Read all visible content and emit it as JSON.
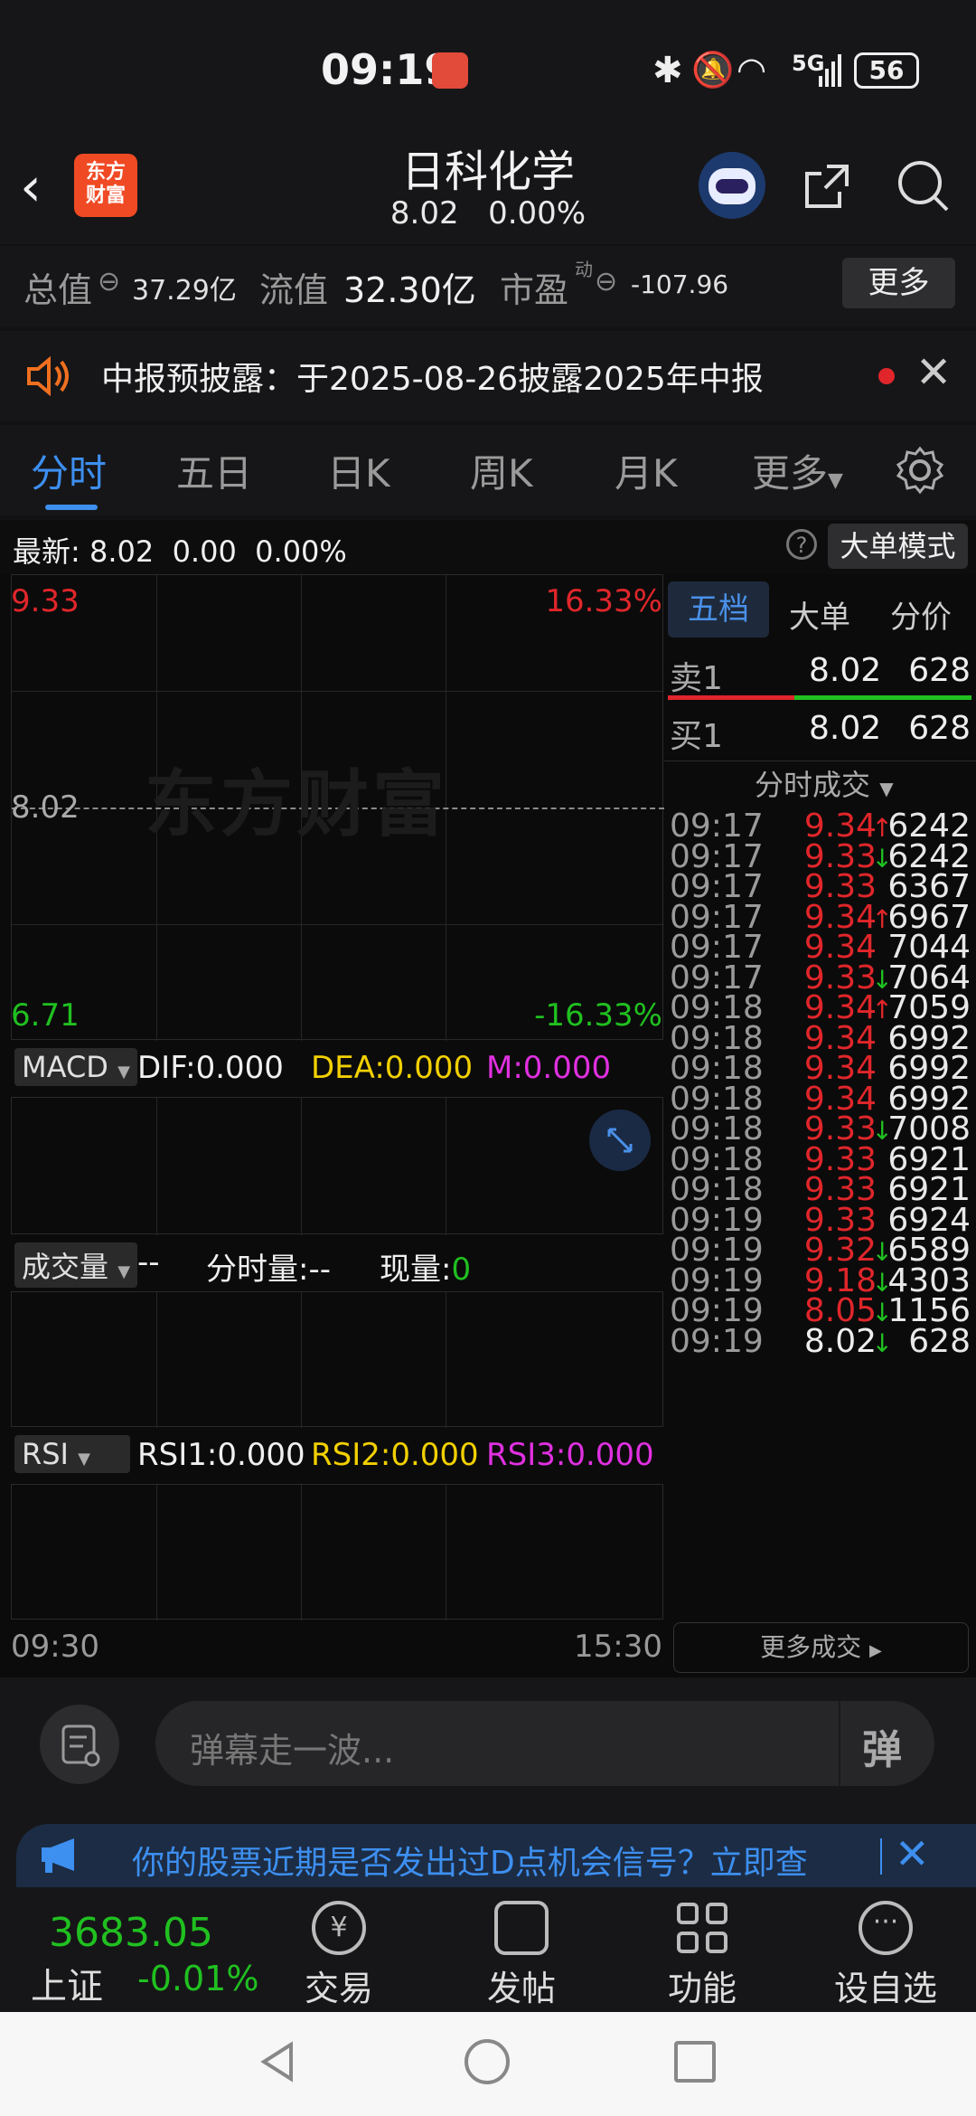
{
  "status_bar": {
    "time": "09:19",
    "network": "5G",
    "battery": "56"
  },
  "header": {
    "logo_text": "东方\n财富",
    "stock_name": "日科化学",
    "price": "8.02",
    "change_pct": "0.00%"
  },
  "info_bar": {
    "total_value_label": "总值",
    "total_value": "37.29亿",
    "float_value_label": "流值",
    "float_value": "32.30亿",
    "pe_label": "市盈",
    "pe_sup": "动",
    "pe_value": "-107.96",
    "more_button": "更多"
  },
  "notice": {
    "text": "中报预披露：于2025-08-26披露2025年中报"
  },
  "tabs": [
    {
      "label": "分时",
      "active": true
    },
    {
      "label": "五日"
    },
    {
      "label": "日K"
    },
    {
      "label": "周K"
    },
    {
      "label": "月K"
    },
    {
      "label": "更多"
    }
  ],
  "latest_bar": {
    "label": "最新:",
    "price": "8.02",
    "change": "0.00",
    "pct": "0.00%",
    "mode_button": "大单模式"
  },
  "chart": {
    "upper_price": "9.33",
    "upper_pct": "16.33%",
    "mid_price": "8.02",
    "lower_price": "6.71",
    "lower_pct": "-16.33%",
    "watermark": "东方财富",
    "time_start": "09:30",
    "time_end": "15:30"
  },
  "macd": {
    "select": "MACD",
    "dif": "DIF:0.000",
    "dea": "DEA:0.000",
    "m": "M:0.000"
  },
  "volume": {
    "select": "成交量",
    "vol": "--",
    "fs_label": "分时量:",
    "fs_value": "--",
    "now_label": "现量:",
    "now_value": "0"
  },
  "rsi": {
    "select": "RSI",
    "rsi1": "RSI1:0.000",
    "rsi2": "RSI2:0.000",
    "rsi3": "RSI3:0.000"
  },
  "side_panel": {
    "tabs": [
      "五档",
      "大单",
      "分价"
    ],
    "sell1": {
      "label": "卖1",
      "price": "8.02",
      "vol": "628"
    },
    "buy1": {
      "label": "买1",
      "price": "8.02",
      "vol": "628"
    },
    "trades_header": "分时成交",
    "trades": [
      {
        "time": "09:17",
        "price": "9.34",
        "arrow": "↑",
        "vol": "6242"
      },
      {
        "time": "09:17",
        "price": "9.33",
        "arrow": "↓",
        "vol": "6242"
      },
      {
        "time": "09:17",
        "price": "9.33",
        "arrow": "",
        "vol": "6367"
      },
      {
        "time": "09:17",
        "price": "9.34",
        "arrow": "↑",
        "vol": "6967"
      },
      {
        "time": "09:17",
        "price": "9.34",
        "arrow": "",
        "vol": "7044"
      },
      {
        "time": "09:17",
        "price": "9.33",
        "arrow": "↓",
        "vol": "7064"
      },
      {
        "time": "09:18",
        "price": "9.34",
        "arrow": "↑",
        "vol": "7059"
      },
      {
        "time": "09:18",
        "price": "9.34",
        "arrow": "",
        "vol": "6992"
      },
      {
        "time": "09:18",
        "price": "9.34",
        "arrow": "",
        "vol": "6992"
      },
      {
        "time": "09:18",
        "price": "9.34",
        "arrow": "",
        "vol": "6992"
      },
      {
        "time": "09:18",
        "price": "9.33",
        "arrow": "↓",
        "vol": "7008"
      },
      {
        "time": "09:18",
        "price": "9.33",
        "arrow": "",
        "vol": "6921"
      },
      {
        "time": "09:18",
        "price": "9.33",
        "arrow": "",
        "vol": "6921"
      },
      {
        "time": "09:19",
        "price": "9.33",
        "arrow": "",
        "vol": "6924"
      },
      {
        "time": "09:19",
        "price": "9.32",
        "arrow": "↓",
        "vol": "6589"
      },
      {
        "time": "09:19",
        "price": "9.18",
        "arrow": "↓",
        "vol": "4303"
      },
      {
        "time": "09:19",
        "price": "8.05",
        "arrow": "↓",
        "vol": "1156"
      },
      {
        "time": "09:19",
        "price": "8.02",
        "arrow": "↓",
        "vol": "628",
        "white": true
      }
    ],
    "more_trades": "更多成交"
  },
  "danmaku": {
    "placeholder": "弹幕走一波...",
    "button": "弹"
  },
  "promo": {
    "text": "你的股票近期是否发出过D点机会信号？立即查"
  },
  "bottom_nav": {
    "index_value": "3683.05",
    "index_name": "上证",
    "index_pct": "-0.01%",
    "items": [
      "交易",
      "发帖",
      "功能",
      "设自选"
    ]
  }
}
